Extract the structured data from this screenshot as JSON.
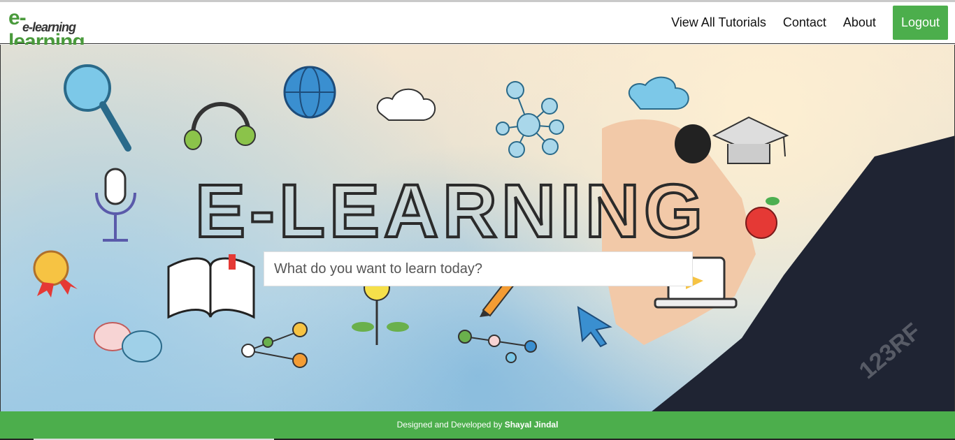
{
  "header": {
    "logo_primary": "e-learning",
    "logo_secondary": "e-learning",
    "nav": [
      {
        "label": "View All Tutorials"
      },
      {
        "label": "Contact"
      },
      {
        "label": "About"
      }
    ],
    "logout_label": "Logout"
  },
  "hero": {
    "banner_text": "E-LEARNING",
    "watermark": "123RF",
    "search": {
      "placeholder": "What do you want to learn today?",
      "value": ""
    }
  },
  "footer": {
    "prefix": "Designed and Developed by ",
    "author": "Shayal Jindal"
  },
  "colors": {
    "accent": "#4cae4c",
    "logo_green": "#4a9a3c"
  },
  "icons": [
    "magnifier-icon",
    "headset-icon",
    "globe-icon",
    "cloud-icon",
    "network-icon",
    "graduation-cap-icon",
    "microphone-icon",
    "apple-icon",
    "award-icon",
    "book-icon",
    "lightbulb-icon",
    "pencil-icon",
    "cursor-icon",
    "laptop-icon",
    "chat-bubbles-icon",
    "share-icon"
  ]
}
